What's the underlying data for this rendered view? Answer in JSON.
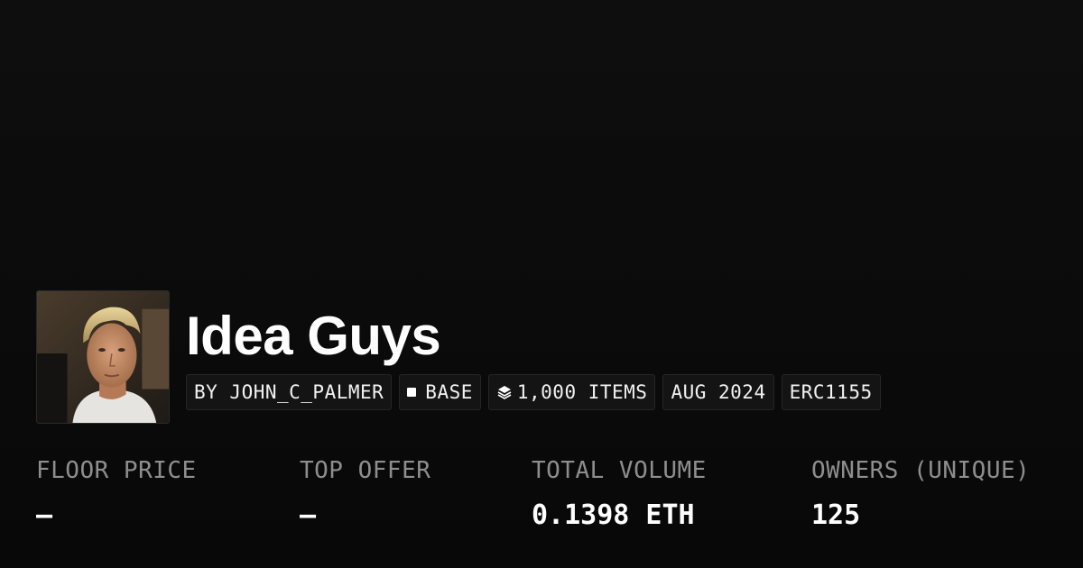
{
  "collection": {
    "name": "Idea Guys",
    "avatar_icon": "profile-photo"
  },
  "badges": {
    "creator": "BY JOHN_C_PALMER",
    "chain": "BASE",
    "items": "1,000 ITEMS",
    "date": "AUG 2024",
    "standard": "ERC1155"
  },
  "stats": [
    {
      "label": "FLOOR PRICE",
      "value": "–"
    },
    {
      "label": "TOP OFFER",
      "value": "–"
    },
    {
      "label": "TOTAL VOLUME",
      "value": "0.1398 ETH"
    },
    {
      "label": "OWNERS (UNIQUE)",
      "value": "125"
    }
  ],
  "colors": {
    "background": "#0c0c0c",
    "text": "#ffffff",
    "muted": "#8e8e8e",
    "badge_bg": "#141414"
  }
}
